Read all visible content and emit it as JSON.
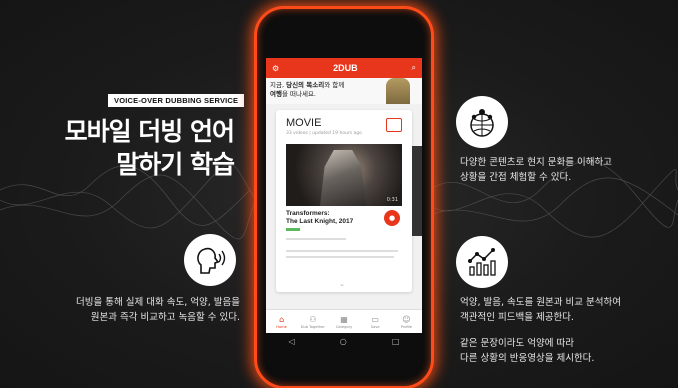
{
  "service_tag": "VOICE-OVER DUBBING SERVICE",
  "headline": {
    "line1": "모바일 더빙 언어",
    "line2": "말하기 학습"
  },
  "left_desc": {
    "line1": "더빙을 통해 실제 대화 속도, 억양, 발음을",
    "line2": "원본과 즉각 비교하고 녹음할 수 있다."
  },
  "right_top_desc": {
    "line1": "다양한 콘텐츠로 현지 문화를 이해하고",
    "line2": "상황을 간접 체험할 수 있다."
  },
  "right_mid_desc": {
    "line1": "억양, 발음, 속도를 원본과 비교 분석하여",
    "line2": "객관적인 피드백을 제공한다."
  },
  "right_bottom_desc": {
    "line1": "같은 문장이라도 억양에 따라",
    "line2": "다른 상황의 반응영상을 제시한다."
  },
  "app": {
    "logo": "2DUB",
    "banner": {
      "line1_a": "지금, ",
      "line1_b": "당신의 목소리",
      "line1_c": "와 함께",
      "line2_a": "여행",
      "line2_b": "을 떠나세요."
    },
    "card": {
      "title": "MOVIE",
      "subtitle": "33 videos | updated 19 hours ago",
      "duration": "0:31",
      "movie_line1": "Transformers:",
      "movie_line2": "The Last Knight, 2017"
    },
    "nav": [
      "Home",
      "Dub Together",
      "Category",
      "Save",
      "Profile"
    ]
  },
  "colors": {
    "accent": "#e8361d",
    "glow": "#ff4a1a",
    "background": "#1b1b1b"
  },
  "icons": [
    "speaking-head-icon",
    "globe-pins-icon",
    "chart-line-icon",
    "gear-icon",
    "search-icon",
    "mic-icon",
    "home-icon",
    "people-icon",
    "grid-icon",
    "folder-icon",
    "user-icon"
  ]
}
